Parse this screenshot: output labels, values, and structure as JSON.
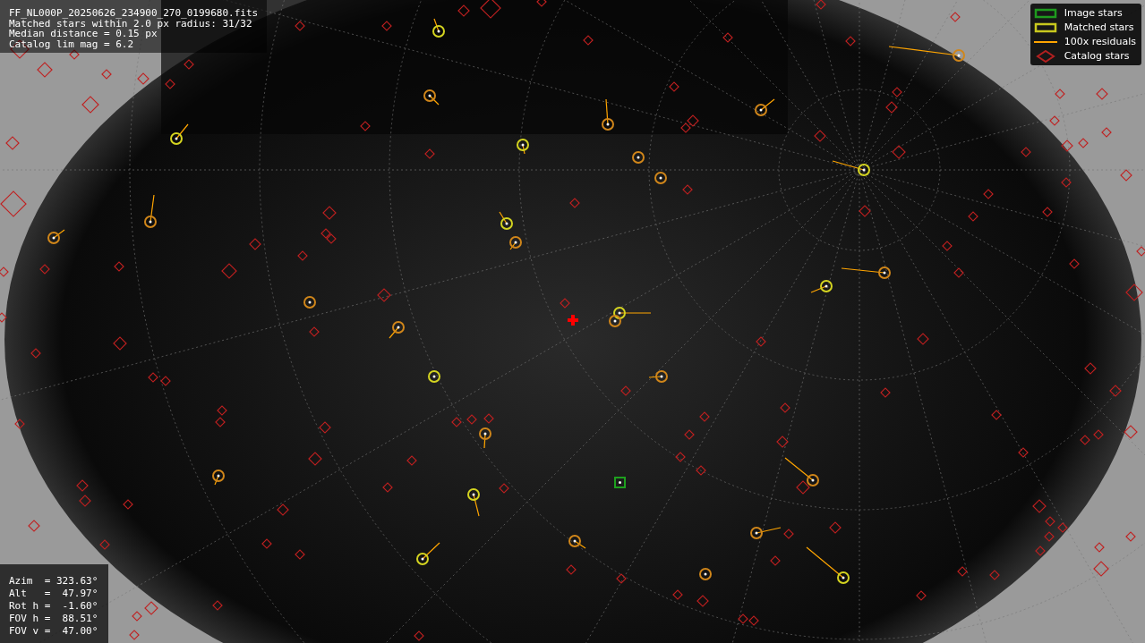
{
  "info_lines": [
    "FF_NL000P_20250626_234900_270_0199680.fits",
    "Matched stars within 2.0 px radius: 31/32",
    "Median distance = 0.15 px",
    "Catalog lim mag = 6.2"
  ],
  "legend": [
    {
      "kind": "box",
      "label": "Image stars",
      "color": "#1e9a1e"
    },
    {
      "kind": "box",
      "label": "Matched stars",
      "color": "#c8c81e"
    },
    {
      "kind": "line",
      "label": "100x residuals",
      "color": "#ffa500"
    },
    {
      "kind": "diamond",
      "label": "Catalog stars",
      "color": "#b42020"
    }
  ],
  "pointing": [
    "Azim  = 323.63°",
    "Alt   =  47.97°",
    "Rot h =  -1.60°",
    "FOV h =  88.51°",
    "FOV v =  47.00°"
  ]
}
